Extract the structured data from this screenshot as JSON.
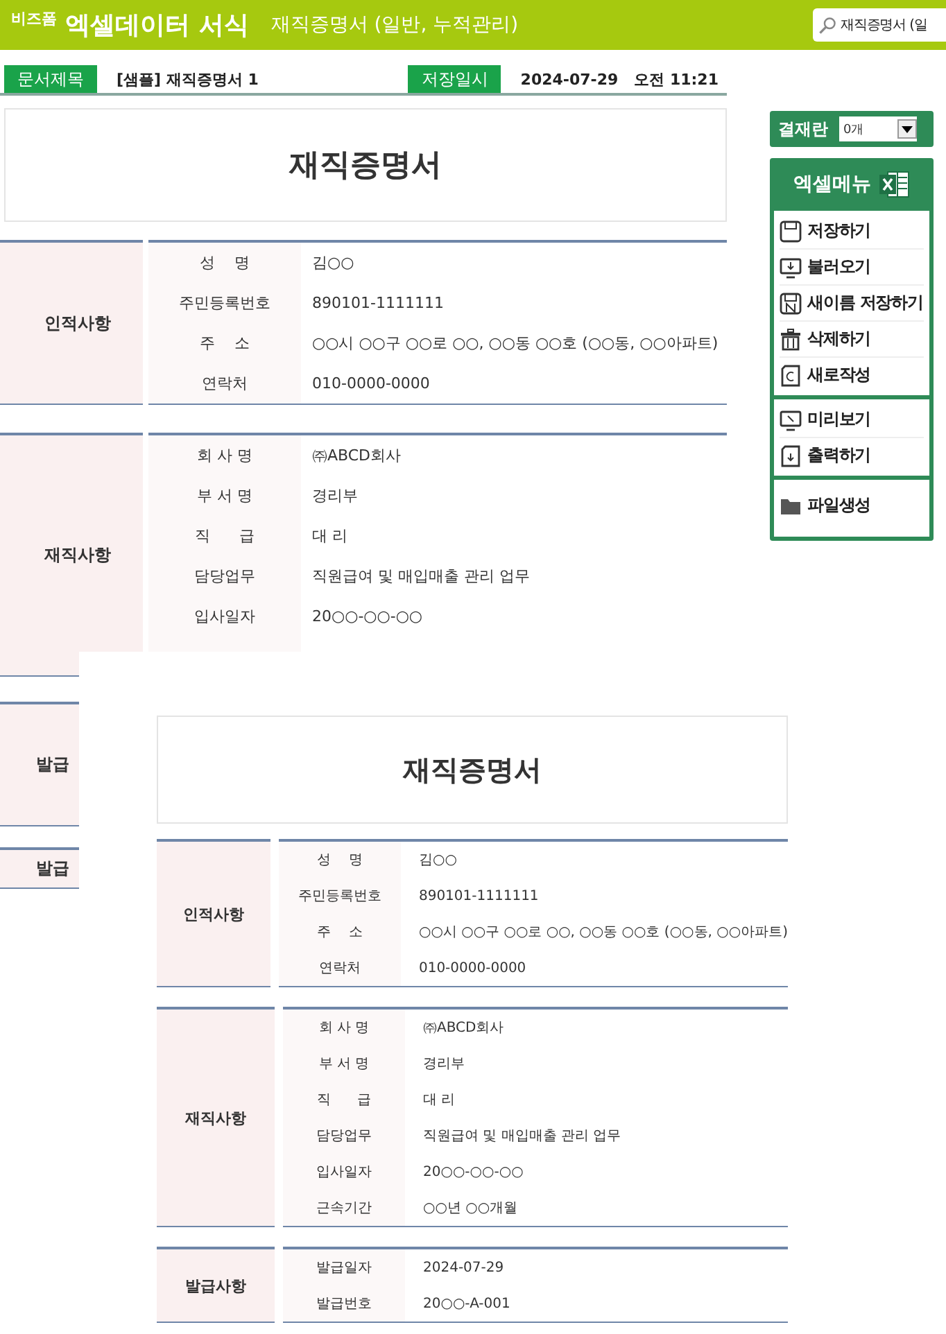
{
  "header": {
    "brand_small": "비즈폼",
    "brand": "엑셀데이터 서식",
    "subtitle": "재직증명서 (일반, 누적관리)",
    "search": {
      "value": "재직증명서 (일"
    }
  },
  "doc_info": [
    {
      "label": "문서제목",
      "value": "[샘플] 재직증명서 1"
    },
    {
      "label": "저장일시",
      "value": "2024-07-29   오전 11:21"
    }
  ],
  "document": {
    "title": "재직증명서",
    "sections": [
      {
        "label": "인적사항",
        "rows": [
          {
            "field": "성    명",
            "value": "김○○"
          },
          {
            "field": "주민등록번호",
            "value": "890101-1111111"
          },
          {
            "field": "주    소",
            "value": "○○시 ○○구 ○○로 ○○, ○○동 ○○호 (○○동, ○○아파트)"
          },
          {
            "field": "연락처",
            "value": "010-0000-0000"
          }
        ]
      },
      {
        "label": "재직사항",
        "rows": [
          {
            "field": "회 사 명",
            "value": "㈜ABCD회사"
          },
          {
            "field": "부 서 명",
            "value": "경리부"
          },
          {
            "field": "직      급",
            "value": "대 리"
          },
          {
            "field": "담당업무",
            "value": "직원급여 및 매입매출 관리 업무"
          },
          {
            "field": "입사일자",
            "value": "20○○-○○-○○"
          }
        ]
      },
      {
        "label": "발급"
      },
      {
        "label": "발급"
      }
    ]
  },
  "side_panel": {
    "approval": {
      "label": "결재란",
      "select": "0개"
    },
    "menu": {
      "title": "엑셀메뉴",
      "groups": [
        [
          {
            "label": "저장하기",
            "kind": "save"
          },
          {
            "label": "불러오기",
            "kind": "load"
          },
          {
            "label": "새이름 저장하기",
            "kind": "saveas"
          },
          {
            "label": "삭제하기",
            "kind": "trash"
          },
          {
            "label": "새로작성",
            "kind": "new"
          }
        ],
        [
          {
            "label": "미리보기",
            "kind": "preview"
          },
          {
            "label": "출력하기",
            "kind": "print"
          }
        ],
        [
          {
            "label": "파일생성",
            "kind": "folder"
          }
        ]
      ]
    }
  },
  "preview": {
    "title": "재직증명서",
    "sections": [
      {
        "label": "인적사항",
        "rows": [
          {
            "field": "성    명",
            "value": "김○○"
          },
          {
            "field": "주민등록번호",
            "value": "890101-1111111"
          },
          {
            "field": "주    소",
            "value": "○○시 ○○구 ○○로 ○○, ○○동 ○○호 (○○동, ○○아파트)"
          },
          {
            "field": "연락처",
            "value": "010-0000-0000"
          }
        ]
      },
      {
        "label": "재직사항",
        "rows": [
          {
            "field": "회 사 명",
            "value": "㈜ABCD회사"
          },
          {
            "field": "부 서 명",
            "value": "경리부"
          },
          {
            "field": "직      급",
            "value": "대 리"
          },
          {
            "field": "담당업무",
            "value": "직원급여 및 매입매출 관리 업무"
          },
          {
            "field": "입사일자",
            "value": "20○○-○○-○○"
          },
          {
            "field": "근속기간",
            "value": "○○년 ○○개월"
          }
        ]
      },
      {
        "label": "발급사항",
        "rows": [
          {
            "field": "발급일자",
            "value": "2024-07-29"
          },
          {
            "field": "발급번호",
            "value": "20○○-A-001"
          }
        ]
      }
    ]
  }
}
